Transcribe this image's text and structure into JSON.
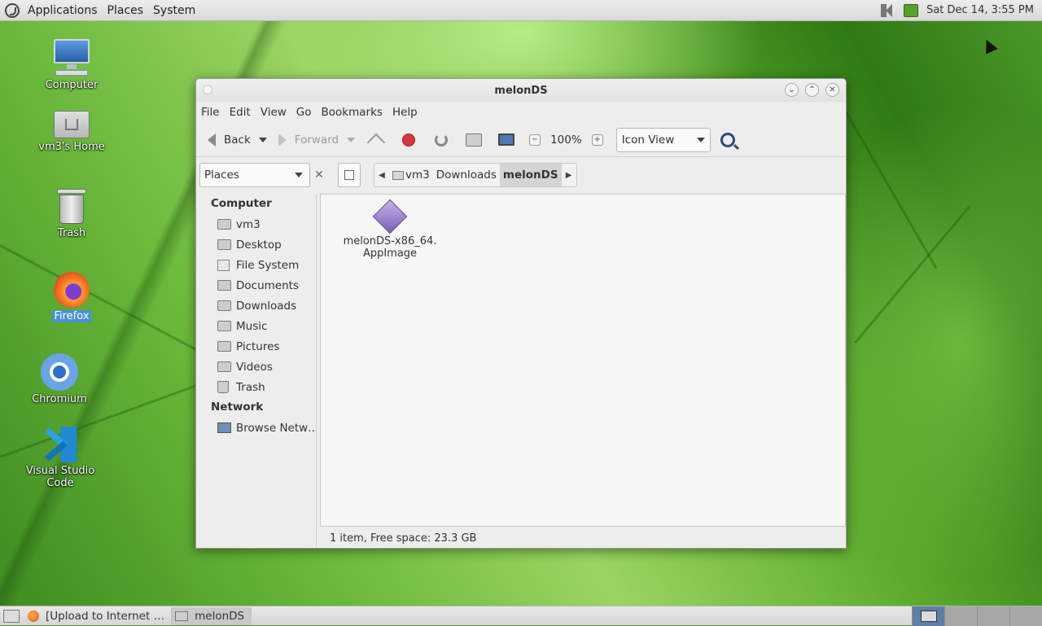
{
  "top_panel": {
    "menus": [
      "Applications",
      "Places",
      "System"
    ],
    "datetime": "Sat Dec 14,  3:55 PM"
  },
  "desktop_icons": [
    {
      "label": "Computer",
      "icon": "computer-icon"
    },
    {
      "label": "vm3's Home",
      "icon": "home-folder-icon"
    },
    {
      "label": "Trash",
      "icon": "trash-icon"
    },
    {
      "label": "Firefox",
      "icon": "firefox-icon",
      "selected": true
    },
    {
      "label": "Chromium",
      "icon": "chromium-icon"
    },
    {
      "label": "Visual Studio Code",
      "icon": "vscode-icon"
    }
  ],
  "window": {
    "title": "melonDS",
    "menu": [
      "File",
      "Edit",
      "View",
      "Go",
      "Bookmarks",
      "Help"
    ],
    "toolbar": {
      "back_label": "Back",
      "forward_label": "Forward",
      "zoom": "100%",
      "view_mode": "Icon View"
    },
    "location": {
      "places_label": "Places",
      "breadcrumbs": [
        "vm3",
        "Downloads",
        "melonDS"
      ]
    },
    "sidebar": {
      "computer_header": "Computer",
      "computer_items": [
        "vm3",
        "Desktop",
        "File System",
        "Documents",
        "Downloads",
        "Music",
        "Pictures",
        "Videos",
        "Trash"
      ],
      "network_header": "Network",
      "network_items": [
        "Browse Netw…"
      ]
    },
    "files": [
      {
        "name_line1": "melonDS-x86_64.",
        "name_line2": "AppImage",
        "icon": "appimage-icon"
      }
    ],
    "status": "1 item, Free space: 23.3 GB"
  },
  "bottom_panel": {
    "tasks": [
      {
        "label": "[Upload to Internet …",
        "icon": "firefox-icon"
      },
      {
        "label": "melonDS",
        "icon": "folder-icon"
      }
    ]
  },
  "colors": {
    "selection": "#4a90d9",
    "stop": "#d9363e",
    "workspace_active": "#5f7fa6"
  }
}
